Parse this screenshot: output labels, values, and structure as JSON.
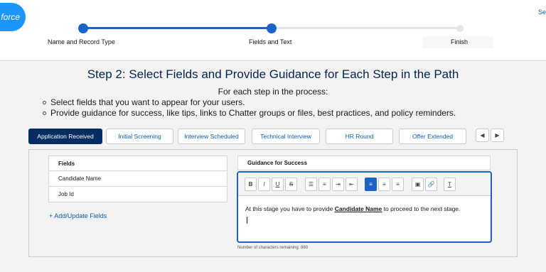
{
  "brand": {
    "logo_text": "force"
  },
  "topbar": {
    "right_link": "Se"
  },
  "path": {
    "steps": [
      {
        "label": "Name and Record Type",
        "state": "complete"
      },
      {
        "label": "Fields and Text",
        "state": "current"
      },
      {
        "label": "Finish",
        "state": "incomplete"
      }
    ]
  },
  "page": {
    "heading": "Step 2: Select Fields and Provide Guidance for Each Step in the Path",
    "subheading": "For each step in the process:",
    "bullets": [
      "Select fields that you want to appear for your users.",
      "Provide guidance for success, like tips, links to Chatter groups or files, best practices, and policy reminders."
    ]
  },
  "tabs": [
    {
      "label": "Application Received",
      "active": true
    },
    {
      "label": "Initial Screening",
      "active": false
    },
    {
      "label": "Interview Scheduled",
      "active": false
    },
    {
      "label": "Technical Interview",
      "active": false
    },
    {
      "label": "HR Round",
      "active": false
    },
    {
      "label": "Offer Extended",
      "active": false
    }
  ],
  "tab_nav": {
    "prev": "◀",
    "next": "▶"
  },
  "fields": {
    "header": "Fields",
    "items": [
      "Candidate Name",
      "Job Id"
    ],
    "add_link": "+ Add/Update Fields"
  },
  "guidance": {
    "header": "Guidance for Success",
    "text_before": "At this stage you have to provide ",
    "merge_field": "Candidate Name",
    "text_after": " to proceed to the next stage.",
    "remaining": "Number of characters remaining: 880"
  },
  "toolbar": {
    "bold": "B",
    "italic": "I",
    "underline": "U",
    "strike": "S",
    "bullet_list": "☰",
    "numbered_list": "≡",
    "indent": "⇥",
    "outdent": "⇤",
    "align_left": "≡",
    "align_center": "≡",
    "align_right": "≡",
    "image": "▣",
    "link": "🔗",
    "clear_format": "T"
  },
  "colors": {
    "accent": "#1b63c6",
    "active_tab": "#032d60",
    "link": "#0b5cab"
  }
}
